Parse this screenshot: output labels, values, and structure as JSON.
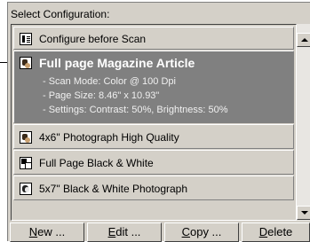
{
  "panel": {
    "title": "Select Configuration:"
  },
  "configurations": [
    {
      "label": "Configure before Scan",
      "icon": "configure-doc-icon",
      "selected": false
    },
    {
      "label": "Full page Magazine Article",
      "icon": "color-photo-icon",
      "selected": true,
      "details": [
        "- Scan Mode: Color @ 100 Dpi",
        "- Page Size:  8.46\" x 10.93\"",
        "- Settings: Contrast: 50%, Brightness: 50%"
      ]
    },
    {
      "label": "4x6\" Photograph High Quality",
      "icon": "color-photo-icon",
      "selected": false
    },
    {
      "label": "Full Page Black & White",
      "icon": "black-white-page-icon",
      "selected": false
    },
    {
      "label": "5x7\" Black & White Photograph",
      "icon": "black-white-photo-icon",
      "selected": false
    }
  ],
  "buttons": {
    "new": {
      "mnemonic": "N",
      "rest": "ew ..."
    },
    "edit": {
      "mnemonic": "E",
      "rest": "dit ..."
    },
    "copy": {
      "mnemonic": "C",
      "rest": "opy ..."
    },
    "delete": {
      "mnemonic": "D",
      "rest": "elete"
    }
  },
  "colors": {
    "face": "#d4d0c8",
    "selected_bg": "#808080",
    "selected_text": "#ffffff"
  }
}
